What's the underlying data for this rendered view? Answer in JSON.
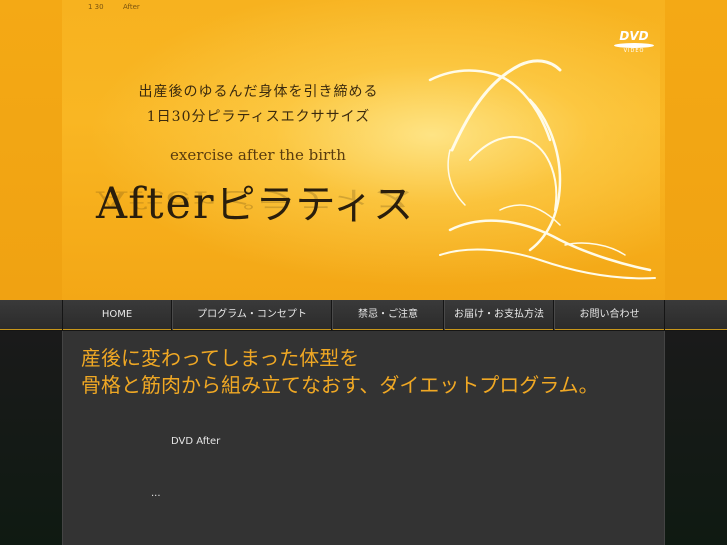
{
  "topbar": {
    "left_text": "1 30",
    "right_text": "After"
  },
  "hero": {
    "tagline_line1": "出産後のゆるんだ身体を引き締める",
    "tagline_line2": "1日30分ピラティスエクササイズ",
    "subtitle": "exercise after the birth",
    "logo_latin": "After",
    "logo_jp": "ピラティス",
    "dvd_text": "DVD",
    "dvd_sub": "VIDEO"
  },
  "nav": {
    "items": [
      {
        "label": "HOME"
      },
      {
        "label": "プログラム・コンセプト"
      },
      {
        "label": "禁忌・ご注意"
      },
      {
        "label": "お届け・お支払方法"
      },
      {
        "label": "お問い合わせ"
      }
    ]
  },
  "main": {
    "headline_line1": "産後に変わってしまった体型を",
    "headline_line2": "骨格と筋肉から組み立てなおす、ダイエットプログラム。",
    "text1": "DVD After",
    "text2": "..."
  },
  "colors": {
    "hero_orange": "#f9b623",
    "headline_orange": "#f0a824",
    "nav_bg": "#2b2b2b",
    "main_bg": "#333333"
  }
}
